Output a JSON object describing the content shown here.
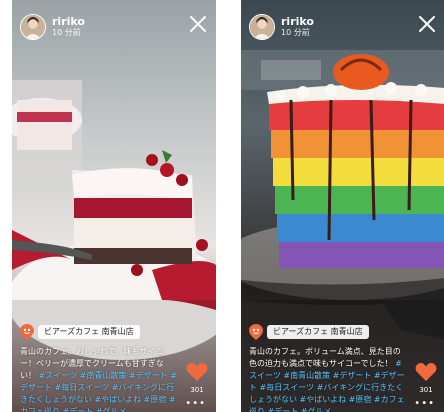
{
  "stories": [
    {
      "user": "ririko",
      "time": "10 分前",
      "shop": "ビアーズカフェ 南青山店",
      "caption": "青山のカフェ。おしゃれで、味もサイコー！ベリーが濃厚でクリームも甘すぎない！",
      "tags": "#スイーツ #南青山散策 #デザート #デザート #毎日スイーツ #バイキングに行きたくしょうがない #やばいよね #原宿 #カフェ巡り #デート #グルメ",
      "likes": "301",
      "more": "•••",
      "icons": {
        "avatar": "avatar-photo",
        "close": "close-icon",
        "shop": "map-pin-icon",
        "like": "heart-icon"
      }
    },
    {
      "user": "ririko",
      "time": "10 分前",
      "shop": "ビアーズカフェ 南青山店",
      "caption": "青山のカフェ。ボリューム満点、見た目の色の迫力も満点で味もサイコーでした！",
      "tags": "#スイーツ #南青山散策 #デザート #デザート #毎日スイーツ #バイキングに行きたくしょうがない #やばいよね #原宿 #カフェ巡り #デート #グルメ",
      "likes": "301",
      "more": "•••",
      "icons": {
        "avatar": "avatar-photo",
        "close": "close-icon",
        "shop": "map-pin-icon",
        "like": "heart-icon"
      }
    }
  ],
  "colors": {
    "heart": "#f06a3e",
    "pin": "#f06a3e",
    "tags": "#56c3ff"
  }
}
